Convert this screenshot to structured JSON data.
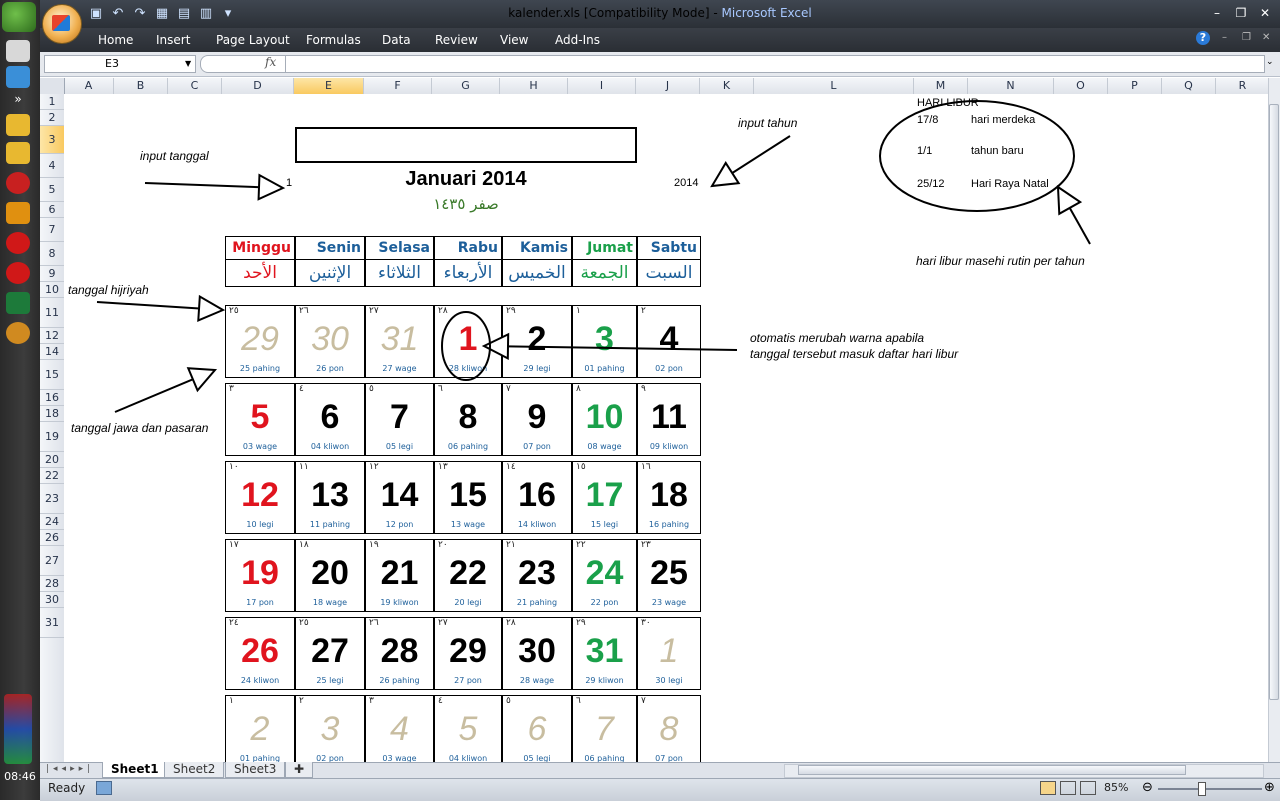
{
  "window": {
    "title_file": "kalender.xls  [Compatibility Mode] - ",
    "title_app": "Microsoft Excel"
  },
  "ribbon": {
    "tabs": [
      "Home",
      "Insert",
      "Page Layout",
      "Formulas",
      "Data",
      "Review",
      "View",
      "Add-Ins"
    ]
  },
  "formula_bar": {
    "name_box": "E3",
    "fx": "fx",
    "value": ""
  },
  "columns": [
    "A",
    "B",
    "C",
    "D",
    "E",
    "F",
    "G",
    "H",
    "I",
    "J",
    "K",
    "L",
    "M",
    "N",
    "O",
    "P",
    "Q",
    "R"
  ],
  "selected_column": "E",
  "rows": [
    "1",
    "2",
    "3",
    "4",
    "5",
    "6",
    "7",
    "8",
    "9",
    "10",
    "11",
    "12",
    "14",
    "15",
    "16",
    "18",
    "19",
    "20",
    "22",
    "23",
    "24",
    "26",
    "27",
    "28",
    "30",
    "31"
  ],
  "selected_row": "3",
  "calendar": {
    "title": "Januari 2014",
    "hijri_title": "صفر ١٤٣٥",
    "input_day": "1",
    "input_year": "2014",
    "day_names": [
      "Minggu",
      "Senin",
      "Selasa",
      "Rabu",
      "Kamis",
      "Jumat",
      "Sabtu"
    ],
    "day_names_ar": [
      "الأحد",
      "الإثنين",
      "الثلاثاء",
      "الأربعاء",
      "الخميس",
      "الجمعة",
      "السبت"
    ],
    "weeks": [
      [
        [
          "٢٥",
          "29",
          "25 pahing",
          "f"
        ],
        [
          "٢٦",
          "30",
          "26 pon",
          "f"
        ],
        [
          "٢٧",
          "31",
          "27 wage",
          "f"
        ],
        [
          "٢٨",
          "1",
          "28 kliwon",
          "r"
        ],
        [
          "٢٩",
          "2",
          "29 legi",
          "k"
        ],
        [
          "١",
          "3",
          "01 pahing",
          "g"
        ],
        [
          "٢",
          "4",
          "02 pon",
          "k"
        ]
      ],
      [
        [
          "٣",
          "5",
          "03 wage",
          "r"
        ],
        [
          "٤",
          "6",
          "04 kliwon",
          "k"
        ],
        [
          "٥",
          "7",
          "05 legi",
          "k"
        ],
        [
          "٦",
          "8",
          "06 pahing",
          "k"
        ],
        [
          "٧",
          "9",
          "07 pon",
          "k"
        ],
        [
          "٨",
          "10",
          "08 wage",
          "g"
        ],
        [
          "٩",
          "11",
          "09 kliwon",
          "k"
        ]
      ],
      [
        [
          "١٠",
          "12",
          "10 legi",
          "r"
        ],
        [
          "١١",
          "13",
          "11 pahing",
          "k"
        ],
        [
          "١٢",
          "14",
          "12 pon",
          "k"
        ],
        [
          "١٣",
          "15",
          "13 wage",
          "k"
        ],
        [
          "١٤",
          "16",
          "14 kliwon",
          "k"
        ],
        [
          "١٥",
          "17",
          "15 legi",
          "g"
        ],
        [
          "١٦",
          "18",
          "16 pahing",
          "k"
        ]
      ],
      [
        [
          "١٧",
          "19",
          "17 pon",
          "r"
        ],
        [
          "١٨",
          "20",
          "18 wage",
          "k"
        ],
        [
          "١٩",
          "21",
          "19 kliwon",
          "k"
        ],
        [
          "٢٠",
          "22",
          "20 legi",
          "k"
        ],
        [
          "٢١",
          "23",
          "21 pahing",
          "k"
        ],
        [
          "٢٢",
          "24",
          "22 pon",
          "g"
        ],
        [
          "٢٣",
          "25",
          "23 wage",
          "k"
        ]
      ],
      [
        [
          "٢٤",
          "26",
          "24 kliwon",
          "r"
        ],
        [
          "٢٥",
          "27",
          "25 legi",
          "k"
        ],
        [
          "٢٦",
          "28",
          "26 pahing",
          "k"
        ],
        [
          "٢٧",
          "29",
          "27 pon",
          "k"
        ],
        [
          "٢٨",
          "30",
          "28 wage",
          "k"
        ],
        [
          "٢٩",
          "31",
          "29 kliwon",
          "g"
        ],
        [
          "٣٠",
          "1",
          "30 legi",
          "f"
        ]
      ],
      [
        [
          "١",
          "2",
          "01 pahing",
          "f"
        ],
        [
          "٢",
          "3",
          "02 pon",
          "f"
        ],
        [
          "٣",
          "4",
          "03 wage",
          "f"
        ],
        [
          "٤",
          "5",
          "04 kliwon",
          "f"
        ],
        [
          "٥",
          "6",
          "05 legi",
          "f"
        ],
        [
          "٦",
          "7",
          "06 pahing",
          "f"
        ],
        [
          "٧",
          "8",
          "07 pon",
          "f"
        ]
      ]
    ]
  },
  "holidays": {
    "header": "HARI LIBUR",
    "items": [
      {
        "date": "17/8",
        "name": "hari merdeka"
      },
      {
        "date": "1/1",
        "name": "tahun baru"
      },
      {
        "date": "25/12",
        "name": "Hari Raya Natal"
      }
    ]
  },
  "notes": {
    "input_tanggal": "input tanggal",
    "input_tahun": "input tahun",
    "tanggal_hijriyah": "tanggal hijriyah",
    "tanggal_jawa": "tanggal jawa dan pasaran",
    "otomatis_1": "otomatis merubah warna apabila",
    "otomatis_2": "tanggal tersebut masuk daftar hari libur",
    "hari_libur_masehi": "hari libur masehi rutin per tahun"
  },
  "sheets": [
    "Sheet1",
    "Sheet2",
    "Sheet3"
  ],
  "active_sheet": "Sheet1",
  "status": {
    "text": "Ready",
    "zoom": "85%"
  },
  "clock": "08:46",
  "colors": {
    "sunday": "#e0141e",
    "friday": "#1aa04a",
    "weekday": "#000000",
    "faded": "#c8bda0",
    "accent": "#1d5f9a"
  }
}
